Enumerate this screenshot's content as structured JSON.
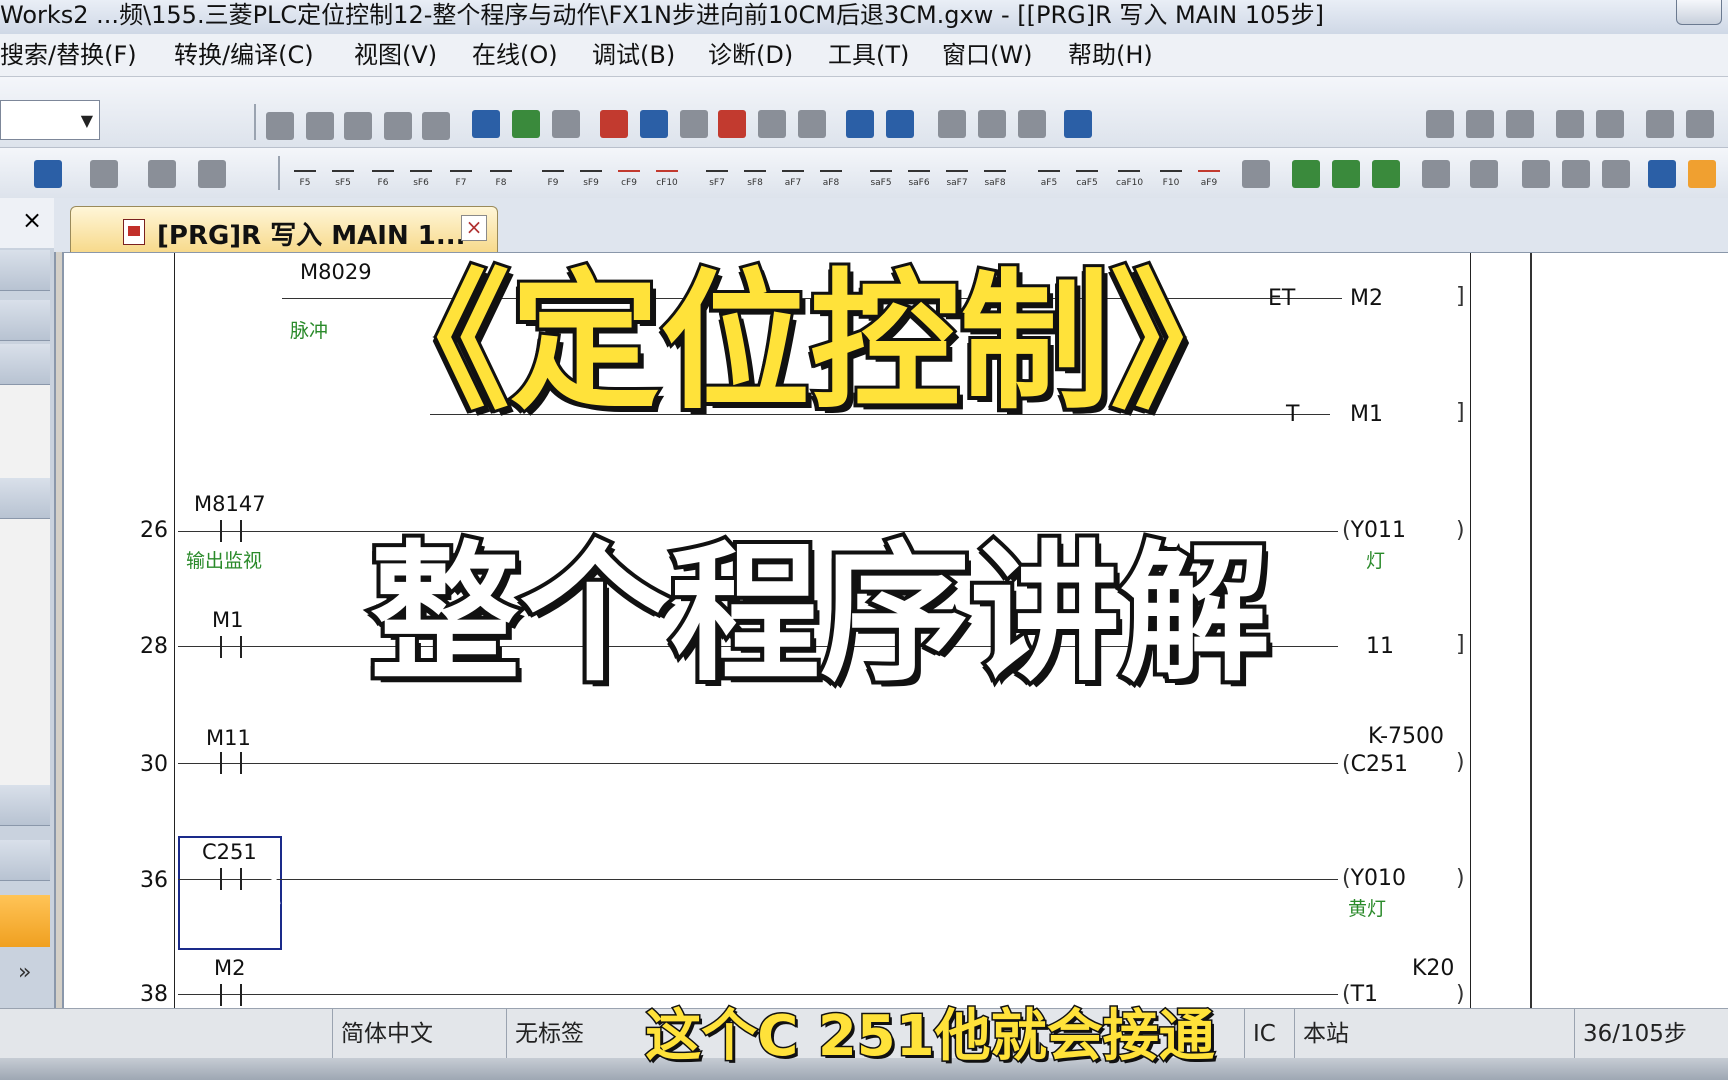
{
  "window": {
    "title": "Works2 ...频\\155.三菱PLC定位控制12-整个程序与动作\\FX1N步进向前10CM后退3CM.gxw - [[PRG]R 写入 MAIN 105步]"
  },
  "menu": {
    "items": [
      "搜索/替换(F)",
      "转换/编译(C)",
      "视图(V)",
      "在线(O)",
      "调试(B)",
      "诊断(D)",
      "工具(T)",
      "窗口(W)",
      "帮助(H)"
    ]
  },
  "toolbar2": {
    "labels": [
      "F5",
      "sF5",
      "F6",
      "sF6",
      "F7",
      "F8",
      "F9",
      "sF9",
      "cF9",
      "cF10",
      "sF7",
      "sF8",
      "aF7",
      "aF8",
      "saF5",
      "saF6",
      "saF7",
      "saF8",
      "aF5",
      "caF5",
      "caF10",
      "F10",
      "aF9"
    ]
  },
  "left_pane": {
    "close": "×",
    "more": "»"
  },
  "tab": {
    "label": "[PRG]R 写入 MAIN 1...",
    "close": "×"
  },
  "ladder": {
    "rows": [
      {
        "device": "M8029",
        "comment": "脉冲",
        "coil_text": "ET",
        "coil": "M2"
      },
      {
        "coil_text": "T",
        "coil": "M1"
      },
      {
        "step": "26",
        "device": "M8147",
        "comment": "输出监视",
        "coil": "Y011",
        "coil_comment": "灯"
      },
      {
        "step": "28",
        "device": "M1",
        "coil": "11"
      },
      {
        "step": "30",
        "device": "M11",
        "coil": "C251",
        "coil_top": "K-7500"
      },
      {
        "step": "36",
        "device": "C251",
        "coil": "Y010",
        "coil_comment": "黄灯"
      },
      {
        "step": "38",
        "device": "M2",
        "coil": "T1",
        "coil_top": "K20"
      }
    ]
  },
  "status": {
    "language": "简体中文",
    "label": "无标签",
    "plc": "IC",
    "station": "本站",
    "steps": "36/105步"
  },
  "overlay": {
    "line1": "《定位控制》",
    "line2": "整个程序讲解",
    "subtitle": "这个C 251他就会接通"
  }
}
